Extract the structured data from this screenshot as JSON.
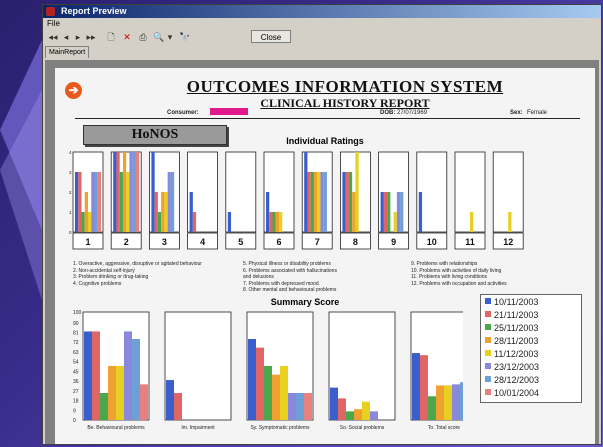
{
  "window": {
    "title": "Report Preview"
  },
  "menu": {
    "file": "File"
  },
  "toolbar": {
    "first_icon": "◂◂",
    "prev_icon": "◂",
    "next_icon": "▸",
    "last_icon": "▸▸",
    "new_icon": "🗋",
    "delete_icon": "✕",
    "print_icon": "⎙",
    "zoom_icon": "🔍",
    "zoom_dropdown": "▾",
    "find_icon": "🔭",
    "close_label": "Close"
  },
  "tabs": {
    "main": "MainReport"
  },
  "report": {
    "title": "OUTCOMES INFORMATION SYSTEM",
    "subtitle": "CLINICAL HISTORY REPORT",
    "consumer_label": "Consumer:",
    "dob_label": "DOB:",
    "dob_value": "27/07/1969",
    "sex_label": "Sex:",
    "sex_value": "Female",
    "honos": "HoNOS",
    "arrow_icon": "➔"
  },
  "item_legend": [
    [
      "1. Overactive, aggressive, disruptive or agitated behaviour",
      "2. Non-accidental self-injury",
      "3. Problem drinking or drug-taking",
      "4. Cognitive problems"
    ],
    [
      "5. Physical illness or disability problems",
      "6. Problems associated with hallucinations",
      "and delusions",
      "7. Problems with depressed mood",
      "8. Other mental and behavioural problems"
    ],
    [
      "9. Problems with relationships",
      "10. Problems with activities of daily living",
      "11. Problems with living conditions",
      "12. Problems with occupation and activities"
    ]
  ],
  "colors": [
    "#3a5fcd",
    "#e06666",
    "#4aa84a",
    "#f0a030",
    "#e8d020",
    "#8888dd",
    "#6ea0d8",
    "#e88080"
  ],
  "dates": [
    "10/11/2003",
    "21/11/2003",
    "25/11/2003",
    "28/11/2003",
    "11/12/2003",
    "23/12/2003",
    "28/12/2003",
    "10/01/2004"
  ],
  "chart_data": [
    {
      "type": "bar",
      "title": "Individual Ratings",
      "categories": [
        "1",
        "2",
        "3",
        "4",
        "5",
        "6",
        "7",
        "8",
        "9",
        "10",
        "11",
        "12"
      ],
      "ylim": [
        0,
        4
      ],
      "yticks": [
        0,
        1,
        2,
        3,
        4
      ],
      "series": [
        {
          "name": "10/11/2003",
          "values": [
            3,
            4,
            4,
            2,
            1,
            2,
            4,
            3,
            2,
            2,
            0,
            0
          ]
        },
        {
          "name": "21/11/2003",
          "values": [
            3,
            4,
            2,
            1,
            0,
            1,
            3,
            3,
            2,
            0,
            0,
            0
          ]
        },
        {
          "name": "25/11/2003",
          "values": [
            1,
            3,
            1,
            0,
            0,
            1,
            3,
            3,
            2,
            0,
            0,
            0
          ]
        },
        {
          "name": "28/11/2003",
          "values": [
            2,
            4,
            2,
            0,
            0,
            1,
            3,
            2,
            0,
            0,
            0,
            0
          ]
        },
        {
          "name": "11/12/2003",
          "values": [
            1,
            3,
            2,
            0,
            0,
            1,
            3,
            4,
            1,
            0,
            1,
            1
          ]
        },
        {
          "name": "23/12/2003",
          "values": [
            3,
            4,
            3,
            0,
            0,
            0,
            3,
            0,
            2,
            0,
            0,
            0
          ]
        },
        {
          "name": "28/12/2003",
          "values": [
            3,
            4,
            3,
            0,
            0,
            0,
            3,
            0,
            2,
            0,
            0,
            0
          ]
        },
        {
          "name": "10/01/2004",
          "values": [
            3,
            4,
            0,
            0,
            0,
            0,
            0,
            0,
            0,
            0,
            0,
            0
          ]
        }
      ]
    },
    {
      "type": "bar",
      "title": "Summary Score",
      "categories": [
        "Be. Behavioural problems",
        "Im. Impairment",
        "Sy. Symptomatic problems",
        "So. Social problems",
        "To. Total score"
      ],
      "ylim": [
        0,
        100
      ],
      "yticks": [
        0,
        9,
        18,
        27,
        36,
        45,
        54,
        63,
        72,
        81,
        90,
        100
      ],
      "series": [
        {
          "name": "10/11/2003",
          "values": [
            82,
            37,
            75,
            30,
            62
          ]
        },
        {
          "name": "21/11/2003",
          "values": [
            82,
            25,
            67,
            20,
            60
          ]
        },
        {
          "name": "25/11/2003",
          "values": [
            25,
            0,
            50,
            8,
            22
          ]
        },
        {
          "name": "28/11/2003",
          "values": [
            50,
            0,
            42,
            10,
            32
          ]
        },
        {
          "name": "11/12/2003",
          "values": [
            50,
            0,
            50,
            17,
            32
          ]
        },
        {
          "name": "23/12/2003",
          "values": [
            82,
            0,
            25,
            8,
            33
          ]
        },
        {
          "name": "28/12/2003",
          "values": [
            75,
            0,
            25,
            0,
            35
          ]
        },
        {
          "name": "10/01/2004",
          "values": [
            33,
            0,
            25,
            0,
            20
          ]
        }
      ]
    }
  ]
}
